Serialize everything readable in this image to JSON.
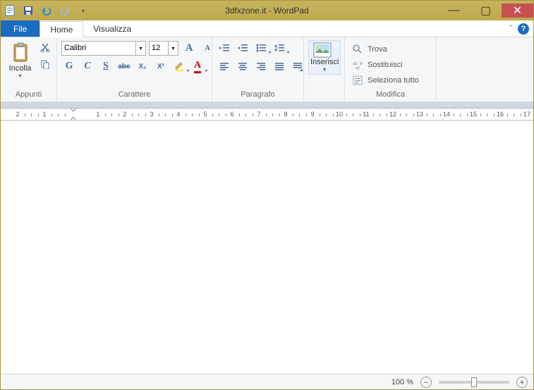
{
  "title": "3dfxzone.it - WordPad",
  "qat": {
    "save": "save",
    "undo": "undo",
    "redo": "redo"
  },
  "window_controls": {
    "minimize": "—",
    "maximize": "▢",
    "close": "✕"
  },
  "tabs": {
    "file": "File",
    "home": "Home",
    "view": "Visualizza"
  },
  "ribbon_corner": {
    "collapse": "ˆ",
    "help": "?"
  },
  "groups": {
    "clipboard": {
      "label": "Appunti",
      "paste": "Incolla"
    },
    "font": {
      "label": "Carattere",
      "font_name": "Calibri",
      "font_size": "12",
      "grow_font": "A",
      "shrink_font": "A",
      "bold": "G",
      "italic": "C",
      "underline": "S",
      "strike": "abc",
      "subscript": "X₂",
      "superscript": "X²"
    },
    "paragraph": {
      "label": "Paragrafo"
    },
    "insert": {
      "label": "",
      "button": "Inserisci"
    },
    "editing": {
      "label": "Modifica",
      "find": "Trova",
      "replace": "Sostituisci",
      "select_all": "Seleziona tutto"
    }
  },
  "statusbar": {
    "zoom_label": "100 %"
  },
  "ruler": {
    "numbers": [
      "2",
      "1",
      "1",
      "2",
      "3",
      "4",
      "5",
      "6",
      "7",
      "8",
      "9",
      "10",
      "11",
      "12",
      "13",
      "14",
      "15",
      "16",
      "17"
    ]
  }
}
